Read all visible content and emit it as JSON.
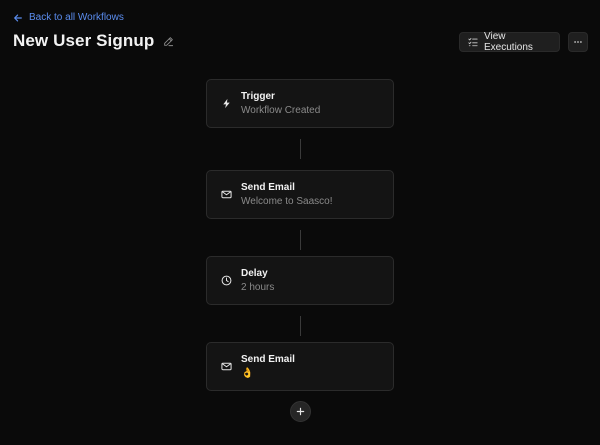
{
  "header": {
    "back_label": "Back to all Workflows",
    "title": "New User Signup",
    "view_executions_label": "View Executions"
  },
  "colors": {
    "background": "#0a0a0a",
    "accent_link": "#5b8def",
    "node_bg": "#141414",
    "muted_text": "#8a8a8a"
  },
  "workflow": {
    "nodes": [
      {
        "icon": "lightning-bolt-icon",
        "title": "Trigger",
        "subtitle": "Workflow Created"
      },
      {
        "icon": "envelope-icon",
        "title": "Send Email",
        "subtitle": "Welcome to Saasco!"
      },
      {
        "icon": "clock-icon",
        "title": "Delay",
        "subtitle": "2 hours"
      },
      {
        "icon": "envelope-icon",
        "title": "Send Email",
        "subtitle": "👌"
      }
    ]
  }
}
